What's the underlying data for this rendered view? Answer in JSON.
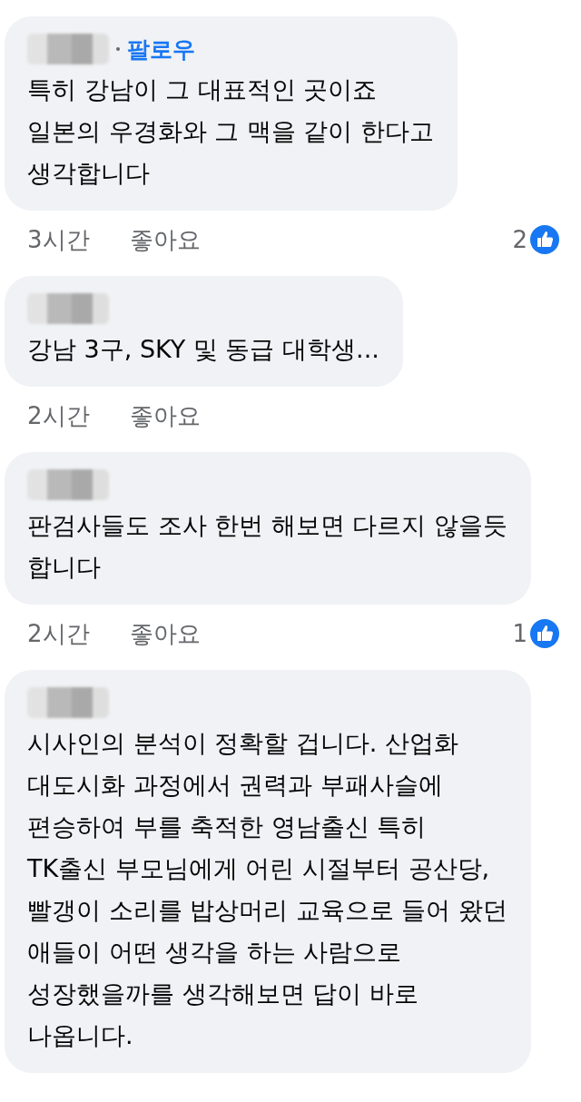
{
  "comments": [
    {
      "follow": "팔로우",
      "lines": [
        "특히 강남이 그 대표적인 곳이죠",
        "일본의 우경화와 그 맥을 같이 한다고",
        "생각합니다"
      ],
      "meta": {
        "time": "3시간",
        "like": "좋아요",
        "reaction_count": "2"
      }
    },
    {
      "lines": [
        "강남 3구, SKY 및 동급 대학생..."
      ],
      "meta": {
        "time": "2시간",
        "like": "좋아요"
      }
    },
    {
      "lines": [
        "판검사들도 조사 한번 해보면 다르지 않을듯",
        "합니다"
      ],
      "meta": {
        "time": "2시간",
        "like": "좋아요",
        "reaction_count": "1"
      }
    },
    {
      "lines": [
        "시사인의 분석이 정확할 겁니다. 산업화",
        "대도시화 과정에서 권력과 부패사슬에",
        "편승하여 부를 축적한 영남출신 특히",
        "TK출신 부모님에게 어린 시절부터 공산당,",
        "빨갱이 소리를 밥상머리 교육으로 들어 왔던",
        "애들이 어떤 생각을 하는 사람으로",
        "성장했을까를 생각해보면 답이 바로",
        "나옵니다."
      ]
    }
  ]
}
